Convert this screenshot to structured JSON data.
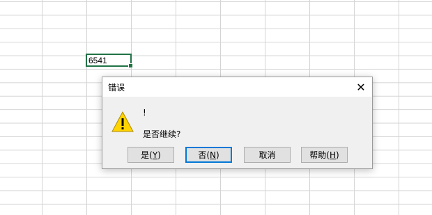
{
  "spreadsheet": {
    "active_cell_value": "6541"
  },
  "dialog": {
    "title": "错误",
    "message_line1": "!",
    "message_line2": "是否继续?",
    "icon": "warning-icon",
    "buttons": {
      "yes": {
        "label": "是",
        "mnemonic_open": "(",
        "mnemonic": "Y",
        "mnemonic_close": ")"
      },
      "no": {
        "label": "否",
        "mnemonic_open": "(",
        "mnemonic": "N",
        "mnemonic_close": ")"
      },
      "cancel": {
        "label": "取消"
      },
      "help": {
        "label": "帮助",
        "mnemonic_open": "(",
        "mnemonic": "H",
        "mnemonic_close": ")"
      }
    },
    "default_button": "no",
    "accent_color": "#0078d7",
    "warning_color": "#ffd400"
  },
  "colors": {
    "cell_selection": "#217346",
    "gridline": "#d4d4d4"
  }
}
